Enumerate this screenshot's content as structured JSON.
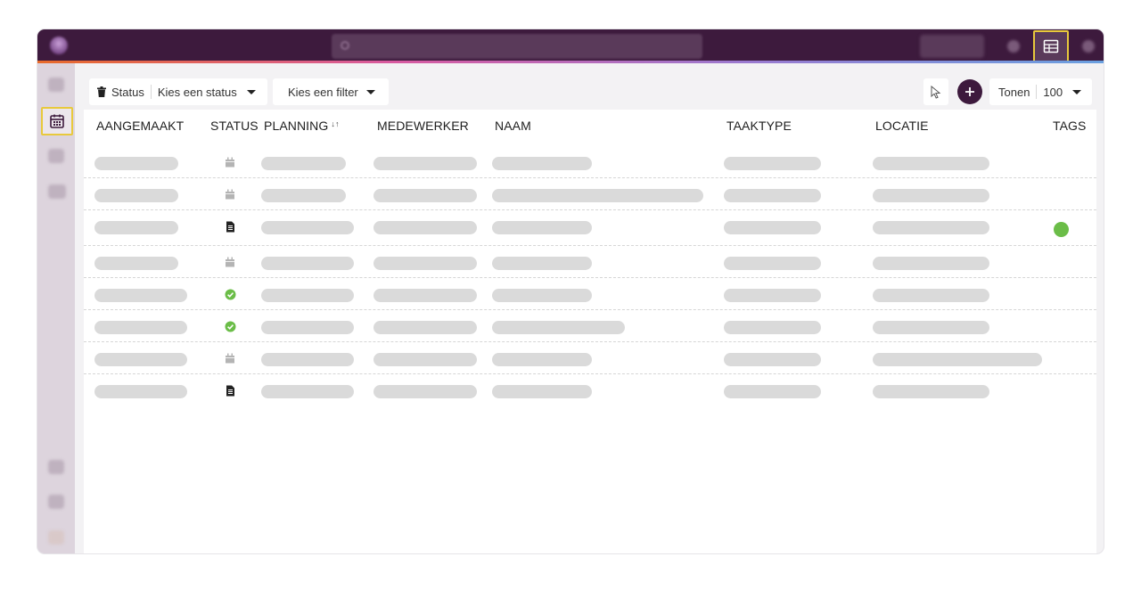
{
  "toolbar": {
    "status_label": "Status",
    "status_select": "Kies een status",
    "filter_select": "Kies een filter",
    "show_label": "Tonen",
    "show_value": "100"
  },
  "table": {
    "columns": [
      "AANGEMAAKT",
      "STATUS",
      "PLANNING",
      "MEDEWERKER",
      "NAAM",
      "TAAKTYPE",
      "LOCATIE",
      "TAGS"
    ],
    "rows": [
      {
        "status_icon": "calendar-icon",
        "tag_color": null
      },
      {
        "status_icon": "calendar-icon",
        "tag_color": null
      },
      {
        "status_icon": "document-icon",
        "tag_color": "#6bbd48"
      },
      {
        "status_icon": "calendar-icon",
        "tag_color": null
      },
      {
        "status_icon": "check-circle-icon",
        "tag_color": null
      },
      {
        "status_icon": "check-circle-icon",
        "tag_color": null
      },
      {
        "status_icon": "calendar-icon",
        "tag_color": null
      },
      {
        "status_icon": "document-icon",
        "tag_color": null
      }
    ]
  },
  "colors": {
    "topbar": "#3d1a3d",
    "highlight": "#e8c93c",
    "check": "#6bbd48",
    "add_button": "#3d1a3d"
  }
}
